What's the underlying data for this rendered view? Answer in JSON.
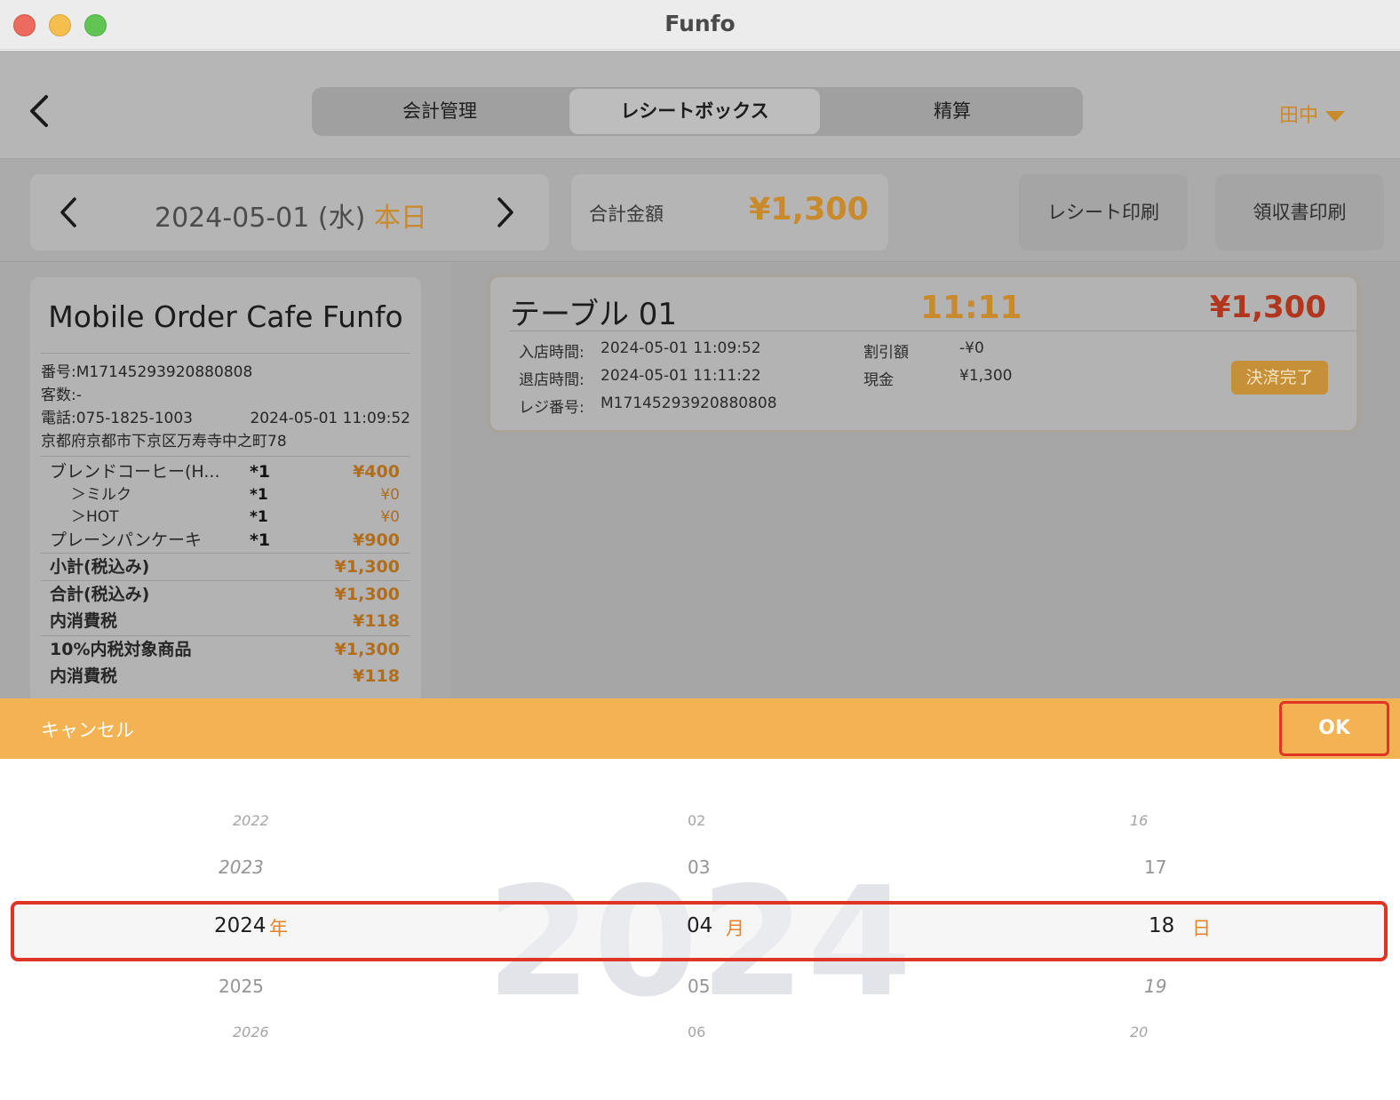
{
  "window": {
    "title": "Funfo"
  },
  "header": {
    "tabs": [
      {
        "label": "会計管理"
      },
      {
        "label": "レシートボックス",
        "active": true
      },
      {
        "label": "精算"
      }
    ],
    "user": "田中"
  },
  "toolbar": {
    "date": "2024-05-01 (水)",
    "today_label": "本日",
    "total_label": "合計金額",
    "total_value": "¥1,300",
    "receipt_print": "レシート印刷",
    "invoice_print": "領収書印刷"
  },
  "receipt": {
    "shop_name": "Mobile Order Cafe Funfo",
    "number": "番号:M17145293920880808",
    "guests": "客数:-",
    "phone": "電話:075-1825-1003",
    "datetime": "2024-05-01 11:09:52",
    "address": "京都府京都市下京区万寿寺中之町78",
    "items": [
      {
        "name": "ブレンドコーヒー(H...",
        "qty": "*1",
        "price": "¥400",
        "sub": false
      },
      {
        "name": "＞ミルク",
        "qty": "*1",
        "price": "¥0",
        "sub": true
      },
      {
        "name": "＞HOT",
        "qty": "*1",
        "price": "¥0",
        "sub": true
      },
      {
        "name": "プレーンパンケーキ",
        "qty": "*1",
        "price": "¥900",
        "sub": false
      }
    ],
    "summary": [
      {
        "label": "小計(税込み)",
        "value": "¥1,300"
      },
      {
        "label": "合計(税込み)",
        "value": "¥1,300"
      },
      {
        "label": "内消費税",
        "value": "¥118"
      },
      {
        "label": "10%内税対象商品",
        "value": "¥1,300"
      },
      {
        "label": "内消費税",
        "value": "¥118"
      }
    ]
  },
  "order_card": {
    "table": "テーブル 01",
    "time": "11:11",
    "amount": "¥1,300",
    "checkin_label": "入店時間:",
    "checkin_value": "2024-05-01 11:09:52",
    "checkout_label": "退店時間:",
    "checkout_value": "2024-05-01 11:11:22",
    "register_label": "レジ番号:",
    "register_value": "M17145293920880808",
    "discount_label": "割引額",
    "discount_value": "-¥0",
    "cash_label": "現金",
    "cash_value": "¥1,300",
    "status": "決済完了"
  },
  "actionbar": {
    "cancel": "キャンセル",
    "ok": "OK"
  },
  "picker": {
    "watermark": "2024",
    "years": [
      "2022",
      "2023",
      "2024",
      "2025",
      "2026"
    ],
    "months": [
      "02",
      "03",
      "04",
      "05",
      "06"
    ],
    "days": [
      "16",
      "17",
      "18",
      "19",
      "20"
    ],
    "year_unit": "年",
    "month_unit": "月",
    "day_unit": "日"
  },
  "colors": {
    "accent": "#f4b353",
    "highlight": "#e03424",
    "unit": "#e8822a"
  }
}
